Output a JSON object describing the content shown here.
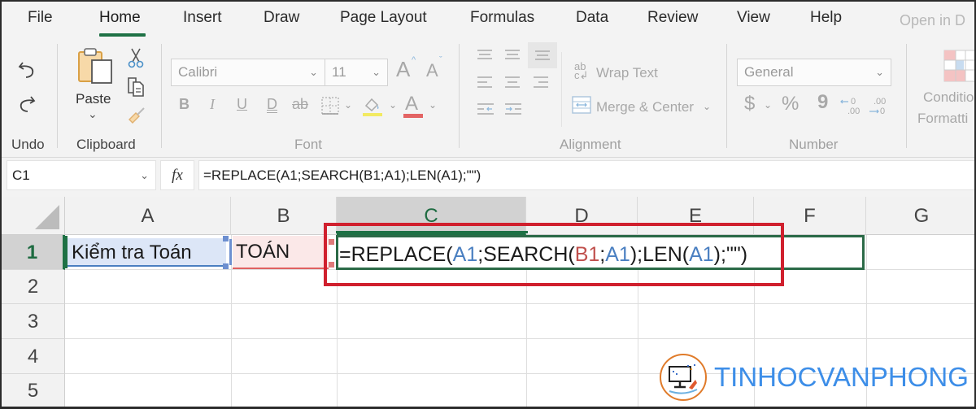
{
  "tabs": [
    {
      "label": "File",
      "active": false
    },
    {
      "label": "Home",
      "active": true
    },
    {
      "label": "Insert",
      "active": false
    },
    {
      "label": "Draw",
      "active": false
    },
    {
      "label": "Page Layout",
      "active": false
    },
    {
      "label": "Formulas",
      "active": false
    },
    {
      "label": "Data",
      "active": false
    },
    {
      "label": "Review",
      "active": false
    },
    {
      "label": "View",
      "active": false
    },
    {
      "label": "Help",
      "active": false
    },
    {
      "label": "Open in D",
      "active": false,
      "disabled": true
    }
  ],
  "accent_color": "#1e7145",
  "ribbon": {
    "undo_group": {
      "label": "Undo",
      "buttons": [
        "undo-icon",
        "redo-icon"
      ]
    },
    "clipboard_group": {
      "label": "Clipboard",
      "paste_label": "Paste",
      "paste_chevron": "⌄",
      "buttons": [
        "cut-icon",
        "copy-icon",
        "format-painter-icon"
      ]
    },
    "font_group": {
      "label": "Font",
      "font_name": "Calibri",
      "font_size": "11",
      "increase_font": "A",
      "decrease_font": "A",
      "bold": "B",
      "italic": "I",
      "underline": "U",
      "double_underline": "D",
      "strikethrough": "ab",
      "font_color": "A"
    },
    "alignment_group": {
      "label": "Alignment",
      "wrap_text": "Wrap Text",
      "merge_center": "Merge & Center"
    },
    "number_group": {
      "label": "Number",
      "format": "General",
      "currency": "$",
      "percent": "%",
      "comma": "9",
      "increase_decimal": "←0 .00",
      "decrease_decimal": ".00 →0"
    },
    "styles_group": {
      "conditional_formatting_line1": "Conditio",
      "conditional_formatting_line2": "Formatti"
    }
  },
  "formula_bar": {
    "name_box": "C1",
    "fx_label": "fx",
    "formula": "=REPLACE(A1;SEARCH(B1;A1);LEN(A1);\"\")"
  },
  "sheet": {
    "columns": [
      "A",
      "B",
      "C",
      "D",
      "E",
      "F",
      "G"
    ],
    "rows": [
      "1",
      "2",
      "3",
      "4",
      "5"
    ],
    "active_cell": "C1",
    "cells": {
      "A1": "Kiểm tra Toán",
      "B1": "TOÁN"
    },
    "c1_formula_parts": [
      {
        "text": "=REPLACE(",
        "type": "plain"
      },
      {
        "text": "A1",
        "type": "ref-a"
      },
      {
        "text": ";SEARCH(",
        "type": "plain"
      },
      {
        "text": "B1",
        "type": "ref-b"
      },
      {
        "text": ";",
        "type": "plain"
      },
      {
        "text": "A1",
        "type": "ref-a"
      },
      {
        "text": ");LEN(",
        "type": "plain"
      },
      {
        "text": "A1",
        "type": "ref-a"
      },
      {
        "text": ");\"\")",
        "type": "plain"
      }
    ],
    "ref_colors": {
      "A1": "#4a7fc1",
      "B1": "#c0504d"
    },
    "highlight_box_color": "#d0202e"
  },
  "watermark": {
    "text": "TINHOCVANPHONG",
    "color": "#3d8ee8"
  }
}
